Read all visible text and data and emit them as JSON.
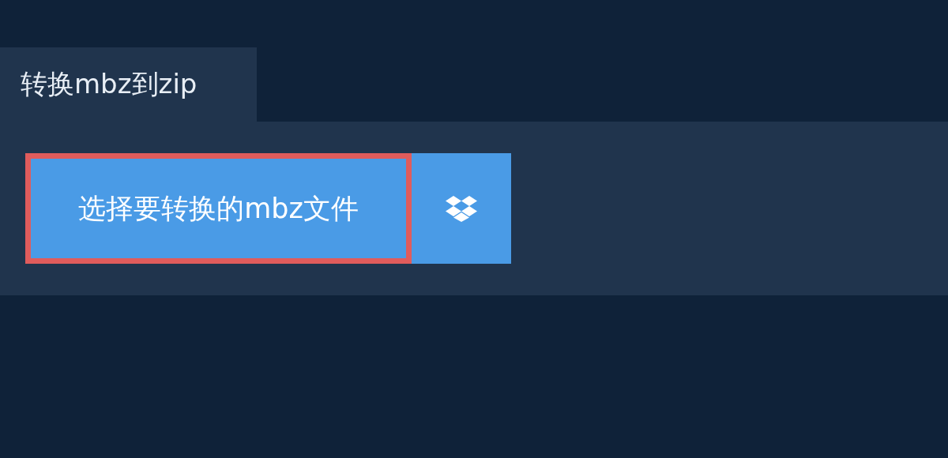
{
  "tab": {
    "label": "转换mbz到zip",
    "selected": true
  },
  "buttons": [
    {
      "kind": "file",
      "label": "选择要转换的mbz文件"
    },
    {
      "kind": "dropbox"
    }
  ]
}
